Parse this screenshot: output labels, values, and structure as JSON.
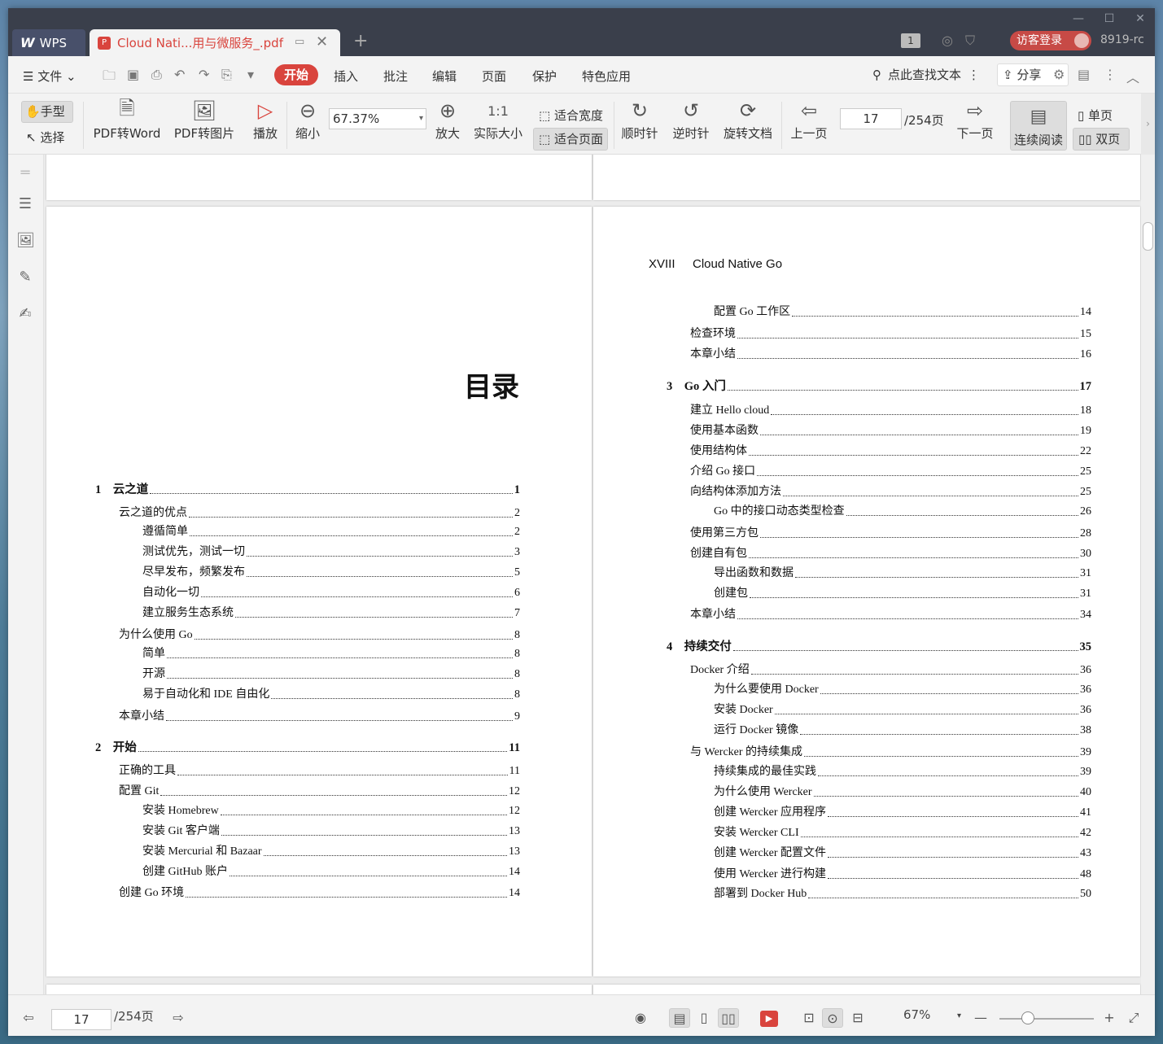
{
  "titlebar": {
    "app_label": "WPS",
    "doc_tab": "Cloud Nati...用与微服务_.pdf",
    "page_badge": "1",
    "login": "访客登录",
    "user": "8919-rc"
  },
  "menu": {
    "file": "文件",
    "tabs": [
      "开始",
      "插入",
      "批注",
      "编辑",
      "页面",
      "保护",
      "特色应用"
    ],
    "search": "点此查找文本",
    "share": "分享"
  },
  "ribbon": {
    "hand": "手型",
    "select": "选择",
    "pdf2word": "PDF转Word",
    "pdf2img": "PDF转图片",
    "play": "播放",
    "zoom_out": "缩小",
    "zoom_value": "67.37%",
    "zoom_in": "放大",
    "actual": "实际大小",
    "fit_width": "适合宽度",
    "fit_page": "适合页面",
    "cw": "顺时针",
    "ccw": "逆时针",
    "rotate": "旋转文档",
    "prev": "上一页",
    "page_current": "17",
    "page_total": "/254页",
    "next": "下一页",
    "continuous": "连续阅读",
    "single": "单页",
    "double": "双页"
  },
  "left_page": {
    "title": "目录",
    "entries": [
      {
        "t": "1　云之道",
        "p": "1",
        "lvl": 0
      },
      {
        "t": "云之道的优点",
        "p": "2",
        "lvl": 1
      },
      {
        "t": "遵循简单",
        "p": "2",
        "lvl": 2
      },
      {
        "t": "测试优先，测试一切",
        "p": "3",
        "lvl": 2
      },
      {
        "t": "尽早发布，频繁发布",
        "p": "5",
        "lvl": 2
      },
      {
        "t": "自动化一切",
        "p": "6",
        "lvl": 2
      },
      {
        "t": "建立服务生态系统",
        "p": "7",
        "lvl": 2
      },
      {
        "t": "为什么使用 Go",
        "p": "8",
        "lvl": 1
      },
      {
        "t": "简单",
        "p": "8",
        "lvl": 2
      },
      {
        "t": "开源",
        "p": "8",
        "lvl": 2
      },
      {
        "t": "易于自动化和 IDE 自由化",
        "p": "8",
        "lvl": 2
      },
      {
        "t": "本章小结",
        "p": "9",
        "lvl": 1
      },
      {
        "t": "2　开始",
        "p": "11",
        "lvl": 0
      },
      {
        "t": "正确的工具",
        "p": "11",
        "lvl": 1
      },
      {
        "t": "配置 Git",
        "p": "12",
        "lvl": 1
      },
      {
        "t": "安装 Homebrew",
        "p": "12",
        "lvl": 2
      },
      {
        "t": "安装 Git 客户端",
        "p": "13",
        "lvl": 2
      },
      {
        "t": "安装 Mercurial 和 Bazaar",
        "p": "13",
        "lvl": 2
      },
      {
        "t": "创建 GitHub 账户",
        "p": "14",
        "lvl": 2
      },
      {
        "t": "创建 Go 环境",
        "p": "14",
        "lvl": 1
      }
    ]
  },
  "right_page": {
    "header_num": "XVIII",
    "header_title": "Cloud Native Go",
    "entries": [
      {
        "t": "配置 Go 工作区",
        "p": "14",
        "lvl": 2
      },
      {
        "t": "检查环境",
        "p": "15",
        "lvl": 1
      },
      {
        "t": "本章小结",
        "p": "16",
        "lvl": 1
      },
      {
        "t": "3　Go 入门",
        "p": "17",
        "lvl": 0
      },
      {
        "t": "建立 Hello cloud",
        "p": "18",
        "lvl": 1
      },
      {
        "t": "使用基本函数",
        "p": "19",
        "lvl": 1
      },
      {
        "t": "使用结构体",
        "p": "22",
        "lvl": 1
      },
      {
        "t": "介绍 Go 接口",
        "p": "25",
        "lvl": 1
      },
      {
        "t": "向结构体添加方法",
        "p": "25",
        "lvl": 1
      },
      {
        "t": "Go 中的接口动态类型检查",
        "p": "26",
        "lvl": 2
      },
      {
        "t": "使用第三方包",
        "p": "28",
        "lvl": 1
      },
      {
        "t": "创建自有包",
        "p": "30",
        "lvl": 1
      },
      {
        "t": "导出函数和数据",
        "p": "31",
        "lvl": 2
      },
      {
        "t": "创建包",
        "p": "31",
        "lvl": 2
      },
      {
        "t": "本章小结",
        "p": "34",
        "lvl": 1
      },
      {
        "t": "4　持续交付",
        "p": "35",
        "lvl": 0
      },
      {
        "t": "Docker 介绍",
        "p": "36",
        "lvl": 1
      },
      {
        "t": "为什么要使用 Docker",
        "p": "36",
        "lvl": 2
      },
      {
        "t": "安装 Docker",
        "p": "36",
        "lvl": 2
      },
      {
        "t": "运行 Docker 镜像",
        "p": "38",
        "lvl": 2
      },
      {
        "t": "与 Wercker 的持续集成",
        "p": "39",
        "lvl": 1
      },
      {
        "t": "持续集成的最佳实践",
        "p": "39",
        "lvl": 2
      },
      {
        "t": "为什么使用 Wercker",
        "p": "40",
        "lvl": 2
      },
      {
        "t": "创建 Wercker 应用程序",
        "p": "41",
        "lvl": 2
      },
      {
        "t": "安装 Wercker CLI",
        "p": "42",
        "lvl": 2
      },
      {
        "t": "创建 Wercker 配置文件",
        "p": "43",
        "lvl": 2
      },
      {
        "t": "使用 Wercker 进行构建",
        "p": "48",
        "lvl": 2
      },
      {
        "t": "部署到 Docker Hub",
        "p": "50",
        "lvl": 2
      }
    ]
  },
  "status": {
    "page_current": "17",
    "page_total": "/254页",
    "zoom": "67%"
  }
}
